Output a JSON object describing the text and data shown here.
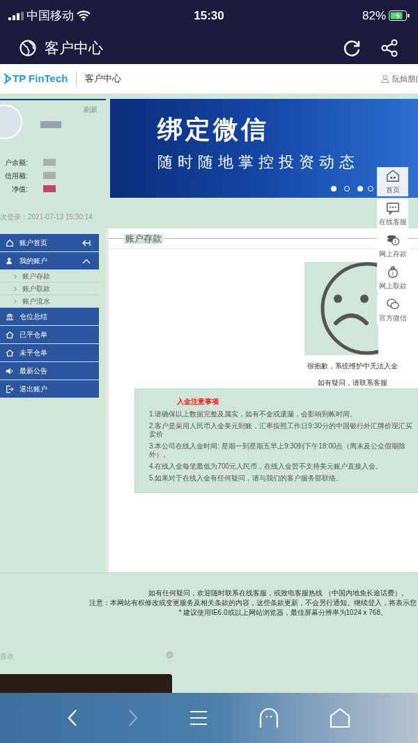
{
  "status_bar": {
    "carrier": "中国移动",
    "time": "15:30",
    "battery": "82%"
  },
  "app_header": {
    "title": "客户中心"
  },
  "site_header": {
    "brand": "TP FinTech",
    "section": "客户中心",
    "user": "阮灿朋("
  },
  "account_panel": {
    "refresh": "刷新",
    "fields": [
      {
        "label": "户余额:"
      },
      {
        "label": "信用额:"
      },
      {
        "label": "净值:"
      }
    ],
    "last_login": "次登录：2021-07-13 15:30:14"
  },
  "banner": {
    "headline": "绑定微信",
    "subline": "随时随地掌控投资动态"
  },
  "quick_links": [
    "首页",
    "在线客服",
    "网上存款",
    "网上取款",
    "官方微信"
  ],
  "menu": [
    {
      "label": "账户首页",
      "kind": "home"
    },
    {
      "label": "我的账户",
      "kind": "user",
      "expanded": true,
      "children": [
        {
          "label": "账户存款"
        },
        {
          "label": "账户取款"
        },
        {
          "label": "账户流水"
        }
      ]
    },
    {
      "label": "仓位总结",
      "kind": "bank"
    },
    {
      "label": "已平仓单",
      "kind": "house"
    },
    {
      "label": "未平仓单",
      "kind": "house"
    },
    {
      "label": "最新公告",
      "kind": "speaker"
    },
    {
      "label": "退出账户",
      "kind": "exit"
    }
  ],
  "content": {
    "title": "账户存款",
    "message": "很抱歉，系统维护中无法入金",
    "contact": "如有疑问，请联系客服",
    "notice_title": "入金注意事项",
    "notices": [
      "1.请确保以上数据完整及属实，如有不全或遗漏，会影响到帐时间。",
      "2.客户是采用人民币入金美元到账，汇率按照工作日9:30分的中国银行外汇牌价现汇买卖价",
      "3.本公司在线入金时间: 星期一到星期五早上9:30到下午18:00点（周末及公众假期除外）。",
      "4.在线入金每笔最低为700元人民币，在线入金暂不支持美元账户直接入金。",
      "5.如果对于在线入金有任何疑问，请与我们的客户服务部联络。"
    ]
  },
  "footer": [
    "如有任何疑问，欢迎随时联系在线客服，或致电客服热线 （中国内地免长途话费）。",
    "注意：本网站有权修改或变更服务及相关条款的内容，这些条款更新，不会另行通知。继续登入，将表示您",
    "* 建议使用IE6.0或以上网站浏览器，最佳屏幕分辨率为1024 x 768。"
  ],
  "recommend": {
    "label": "喜欢"
  }
}
